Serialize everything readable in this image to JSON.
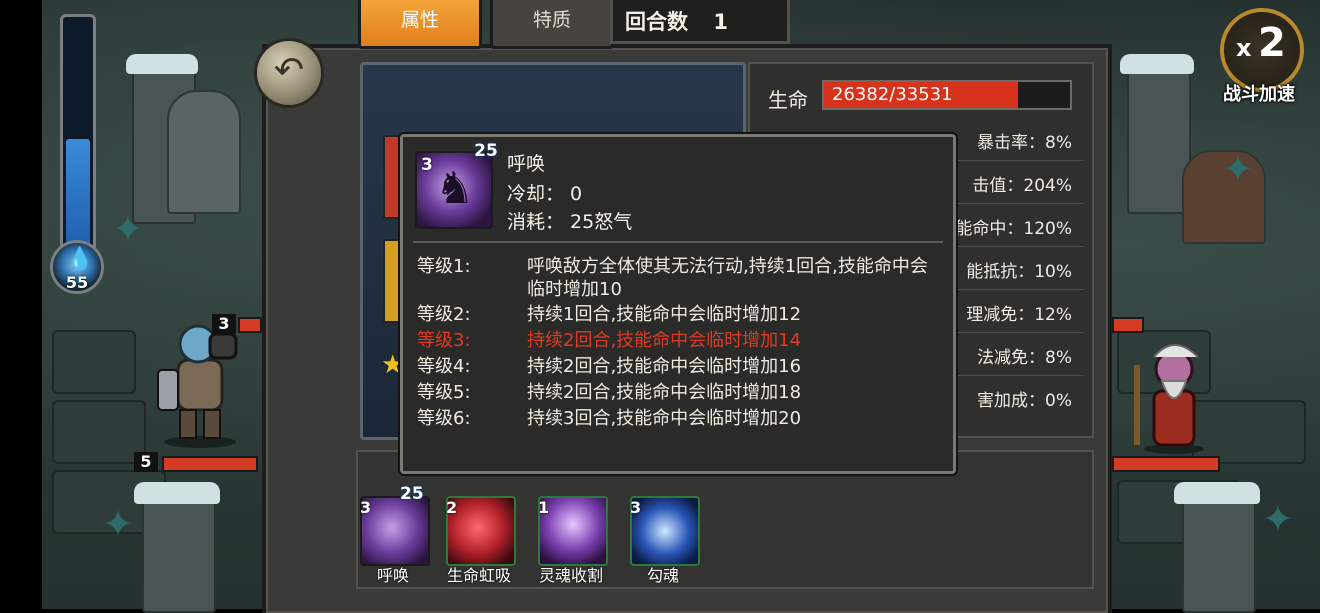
{
  "tabs": [
    {
      "label": "属性",
      "active": true
    },
    {
      "label": "特质",
      "active": false
    }
  ],
  "round": {
    "label": "回合数",
    "value": "1"
  },
  "speed": {
    "multiplier_x": "x",
    "multiplier_value": "2",
    "label": "战斗加速"
  },
  "energy": {
    "value": "55",
    "fill_fraction": 0.46
  },
  "units": {
    "left_top_level": "3",
    "left_bottom_level": "5"
  },
  "stats": {
    "hp_label": "生命",
    "hp_text": "26382/33531",
    "hp_fraction": 0.787,
    "rows": [
      "暴击率：8%",
      "击值：204%",
      "能命中：120%",
      "能抵抗：10%",
      "理减免：12%",
      "法减免：8%",
      "害加成：0%"
    ]
  },
  "tooltip": {
    "icon_level": "3",
    "cost_badge": "25",
    "name": "呼唤",
    "cooldown": "冷却： 0",
    "cost": "消耗： 25怒气",
    "levels": [
      {
        "name": "等级1:",
        "desc": "呼唤敌方全体使其无法行动,持续1回合,技能命中会临时增加10",
        "active": false
      },
      {
        "name": "等级2:",
        "desc": "持续1回合,技能命中会临时增加12",
        "active": false
      },
      {
        "name": "等级3:",
        "desc": "持续2回合,技能命中会临时增加14",
        "active": true
      },
      {
        "name": "等级4:",
        "desc": "持续2回合,技能命中会临时增加16",
        "active": false
      },
      {
        "name": "等级5:",
        "desc": "持续2回合,技能命中会临时增加18",
        "active": false
      },
      {
        "name": "等级6:",
        "desc": "持续3回合,技能命中会临时增加20",
        "active": false
      }
    ]
  },
  "skills": [
    {
      "label": "呼唤",
      "level": "3",
      "cost": "25",
      "color": "#6a3b9a"
    },
    {
      "label": "生命虹吸",
      "level": "2",
      "cost": "",
      "color": "#b0202a"
    },
    {
      "label": "灵魂收割",
      "level": "1",
      "cost": "",
      "color": "#7a3fb0"
    },
    {
      "label": "勾魂",
      "level": "3",
      "cost": "",
      "color": "#2a56b8"
    }
  ]
}
